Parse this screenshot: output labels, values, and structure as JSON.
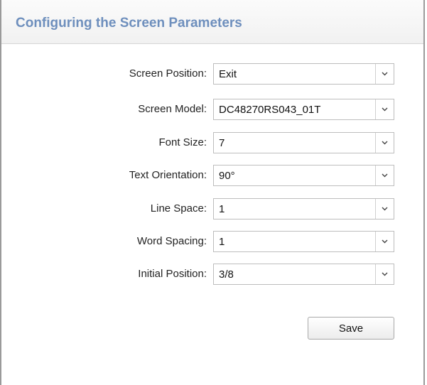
{
  "header": {
    "title": "Configuring the Screen Parameters"
  },
  "form": {
    "fields": [
      {
        "label": "Screen Position:",
        "value": "Exit"
      },
      {
        "label": "Screen Model:",
        "value": "DC48270RS043_01T"
      },
      {
        "label": "Font Size:",
        "value": "7"
      },
      {
        "label": "Text Orientation:",
        "value": "90°"
      },
      {
        "label": "Line Space:",
        "value": "1"
      },
      {
        "label": "Word Spacing:",
        "value": "1"
      },
      {
        "label": "Initial Position:",
        "value": "3/8"
      }
    ],
    "save_label": "Save"
  },
  "colors": {
    "title": "#6e8fbd",
    "border": "#9a9a9a"
  },
  "icons": {
    "dropdown": "chevron-down-icon"
  }
}
